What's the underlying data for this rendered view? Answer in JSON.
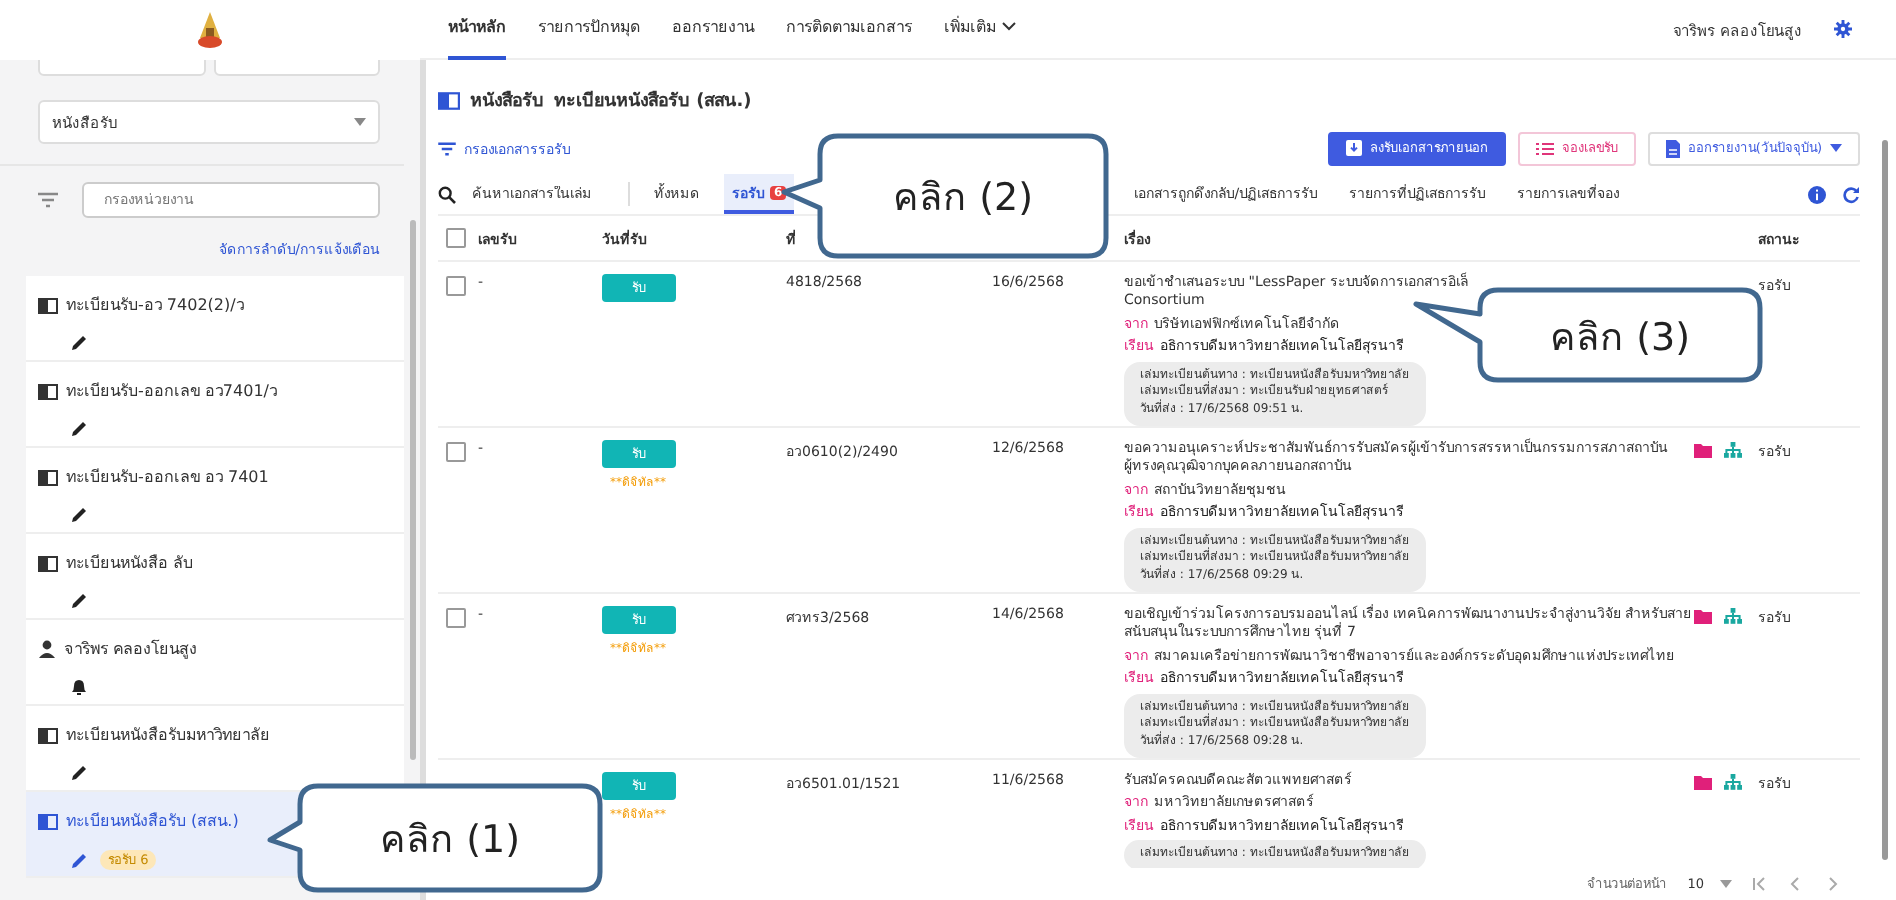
{
  "nav": {
    "tabs": [
      {
        "label": "หน้าหลัก",
        "selected": true,
        "dropdown": false
      },
      {
        "label": "รายการปักหมุด",
        "selected": false,
        "dropdown": false
      },
      {
        "label": "ออกรายงาน",
        "selected": false,
        "dropdown": false
      },
      {
        "label": "การติดตามเอกสาร",
        "selected": false,
        "dropdown": false
      },
      {
        "label": "เพิ่มเติม",
        "selected": false,
        "dropdown": true
      }
    ],
    "user": "จาริพร คลองโยนสูง"
  },
  "sidebar": {
    "type_select": "หนังสือรับ",
    "unit_filter": {
      "placeholder": "กรองหน่วยงาน"
    },
    "manage_link": "จัดการลำดับ/การแจ้งเตือน",
    "items": [
      {
        "kind": "book",
        "label": "ทะเบียนรับ-อว 7402(2)/ว",
        "selected": false
      },
      {
        "kind": "book",
        "label": "ทะเบียนรับ-ออกเลข อว7401/ว",
        "selected": false
      },
      {
        "kind": "book",
        "label": "ทะเบียนรับ-ออกเลข อว 7401",
        "selected": false
      },
      {
        "kind": "book",
        "label": "ทะเบียนหนังสือ ลับ",
        "selected": false
      },
      {
        "kind": "person",
        "label": "จาริพร คลองโยนสูง",
        "selected": false
      },
      {
        "kind": "book",
        "label": "ทะเบียนหนังสือรับมหาวิทยาลัย",
        "selected": false
      },
      {
        "kind": "book",
        "label": "ทะเบียนหนังสือรับ (สสน.)",
        "selected": true,
        "badge": "รอรับ 6"
      }
    ]
  },
  "page": {
    "category": "หนังสือรับ",
    "title": "ทะเบียนหนังสือรับ (สสน.)",
    "filter_link": "กรองเอกสารรอรับ",
    "buttons": [
      {
        "kind": "primary",
        "label": "ลงรับเอกสารภายนอก"
      },
      {
        "kind": "outline",
        "label": "จองเลขรับ"
      },
      {
        "kind": "dropdown",
        "label": "ออกรายงาน(วันปัจจุบัน)"
      }
    ],
    "search": {
      "placeholder": "ค้นหาเอกสารในเล่ม"
    },
    "tabs": [
      {
        "label": "ทั้งหมด",
        "selected": false
      },
      {
        "label": "รอรับ",
        "count": "6",
        "selected": true
      },
      {
        "label": "เอกสารถูกดึงกลับ/ปฏิเสธการรับ",
        "selected": false
      },
      {
        "label": "รายการที่ปฏิเสธการรับ",
        "selected": false
      },
      {
        "label": "รายการเลขที่จอง",
        "selected": false
      }
    ]
  },
  "table": {
    "select_all_checked": false,
    "columns": [
      "เลขรับ",
      "วันที่รับ",
      "ที่",
      "เรื่อง",
      "สถานะ"
    ],
    "rows": [
      {
        "checked": false,
        "number": "-",
        "receive": "รับ",
        "digital": null,
        "ref": "4818/2568",
        "date": "16/6/2568",
        "subject": "ขอเข้าชำเสนอระบบ \"LessPaper ระบบจัดการเอกสารอิเล็\nConsortium",
        "from_label": "จาก",
        "from": "บริษัทเอฟฟิกซ์เทคโนโลยีจำกัด",
        "to_label": "เรียน",
        "to": "อธิการบดีมหาวิทยาลัยเทคโนโลยีสุรนารี",
        "info": [
          "เล่มทะเบียนต้นทาง : ทะเบียนหนังสือรับมหาวิทยาลัย",
          "เล่มทะเบียนที่ส่งมา : ทะเบียนรับฝ่ายยุทธศาสตร์",
          "วันที่ส่ง : 17/6/2568 09:51 น."
        ],
        "actions": false,
        "status": "รอรับ"
      },
      {
        "checked": false,
        "number": "-",
        "receive": "รับ",
        "digital": "**ดิจิทัล**",
        "ref": "อว0610(2)/2490",
        "date": "12/6/2568",
        "subject": "ขอความอนุเคราะห์ประชาสัมพันธ์การรับสมัครผู้เข้ารับการสรรหาเป็นกรรมการสภาสถาบันผู้ทรงคุณวุฒิจากบุคคลภายนอกสถาบัน",
        "from_label": "จาก",
        "from": "สถาบันวิทยาลัยชุมชน",
        "to_label": "เรียน",
        "to": "อธิการบดีมหาวิทยาลัยเทคโนโลยีสุรนารี",
        "info": [
          "เล่มทะเบียนต้นทาง : ทะเบียนหนังสือรับมหาวิทยาลัย",
          "เล่มทะเบียนที่ส่งมา : ทะเบียนหนังสือรับมหาวิทยาลัย",
          "วันที่ส่ง : 17/6/2568 09:29 น."
        ],
        "actions": true,
        "status": "รอรับ"
      },
      {
        "checked": false,
        "number": "-",
        "receive": "รับ",
        "digital": "**ดิจิทัล**",
        "ref": "ศวทร3/2568",
        "date": "14/6/2568",
        "subject": "ขอเชิญเข้าร่วมโครงการอบรมออนไลน์ เรื่อง เทคนิคการพัฒนางานประจำสู่งานวิจัย สำหรับสายสนับสนุนในระบบการศึกษาไทย รุ่นที่ 7",
        "from_label": "จาก",
        "from": "สมาคมเครือข่ายการพัฒนาวิชาชีพอาจารย์และองค์กรระดับอุดมศึกษาแห่งประเทศไทย",
        "to_label": "เรียน",
        "to": "อธิการบดีมหาวิทยาลัยเทคโนโลยีสุรนารี",
        "info": [
          "เล่มทะเบียนต้นทาง : ทะเบียนหนังสือรับมหาวิทยาลัย",
          "เล่มทะเบียนที่ส่งมา : ทะเบียนหนังสือรับมหาวิทยาลัย",
          "วันที่ส่ง : 17/6/2568 09:28 น."
        ],
        "actions": true,
        "status": "รอรับ"
      },
      {
        "receive": "รับ",
        "digital": "**ดิจิทัล**",
        "ref": "อว6501.01/1521",
        "date": "11/6/2568",
        "subject": "รับสมัครคณบดีคณะสัตวแพทยศาสตร์",
        "from_label": "จาก",
        "from": "มหาวิทยาลัยเกษตรศาสตร์",
        "to_label": "เรียน",
        "to": "อธิการบดีมหาวิทยาลัยเทคโนโลยีสุรนารี",
        "info": [
          "เล่มทะเบียนต้นทาง : ทะเบียนหนังสือรับมหาวิทยาลัย"
        ],
        "actions": true,
        "status": "รอรับ"
      }
    ]
  },
  "pagination": {
    "label": "จำนวนต่อหน้า",
    "per_page": "10"
  },
  "callouts": [
    {
      "label": "คลิก (1)"
    },
    {
      "label": "คลิก (2)"
    },
    {
      "label": "คลิก (3)"
    }
  ]
}
